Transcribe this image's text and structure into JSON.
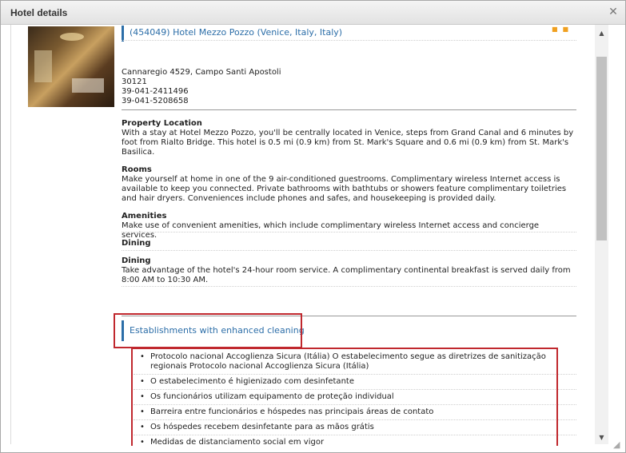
{
  "window": {
    "title": "Hotel details",
    "close_icon": "close-icon"
  },
  "hotel": {
    "name": "(454049) Hotel Mezzo Pozzo (Venice, Italy, Italy)",
    "rating_icons": "star-icon",
    "photo_icon": "hotel-photo",
    "address_lines": [
      "Cannaregio 4529, Campo Santi Apostoli",
      "30121",
      "39-041-2411496",
      "39-041-5208658"
    ]
  },
  "sections": [
    {
      "heading": "Property Location",
      "text": "With a stay at Hotel Mezzo Pozzo, you'll be centrally located in Venice, steps from Grand Canal and 6 minutes by foot from Rialto Bridge. This hotel is 0.5 mi (0.9 km) from St. Mark's Square and 0.6 mi (0.9 km) from St. Mark's Basilica."
    },
    {
      "heading": "Rooms",
      "text": "Make yourself at home in one of the 9 air-conditioned guestrooms. Complimentary wireless Internet access is available to keep you connected. Private bathrooms with bathtubs or showers feature complimentary toiletries and hair dryers. Conveniences include phones and safes, and housekeeping is provided daily."
    },
    {
      "heading": "Amenities",
      "text": "Make use of convenient amenities, which include complimentary wireless Internet access and concierge services."
    },
    {
      "heading": "Dining",
      "text": ""
    },
    {
      "heading": "Dining",
      "text": "Take advantage of the hotel's 24-hour room service. A complimentary continental breakfast is served daily from 8:00 AM to 10:30 AM."
    }
  ],
  "cleaning": {
    "title": "Establishments with enhanced cleaning",
    "items": [
      "Protocolo nacional Accoglienza Sicura (Itália) O estabelecimento segue as diretrizes de sanitização regionais Protocolo nacional Accoglienza Sicura (Itália)",
      "O estabelecimento é higienizado com desinfetante",
      "Os funcionários utilizam equipamento de proteção individual",
      "Barreira entre funcionários e hóspedes nas principais áreas de contato",
      "Os hóspedes recebem desinfetante para as mãos grátis",
      "Medidas de distanciamento social em vigor"
    ]
  },
  "colors": {
    "accent": "#2c6ea8",
    "highlight": "#c0282e"
  },
  "scrollbar": {
    "up_icon": "arrow-up-icon",
    "down_icon": "arrow-down-icon"
  }
}
